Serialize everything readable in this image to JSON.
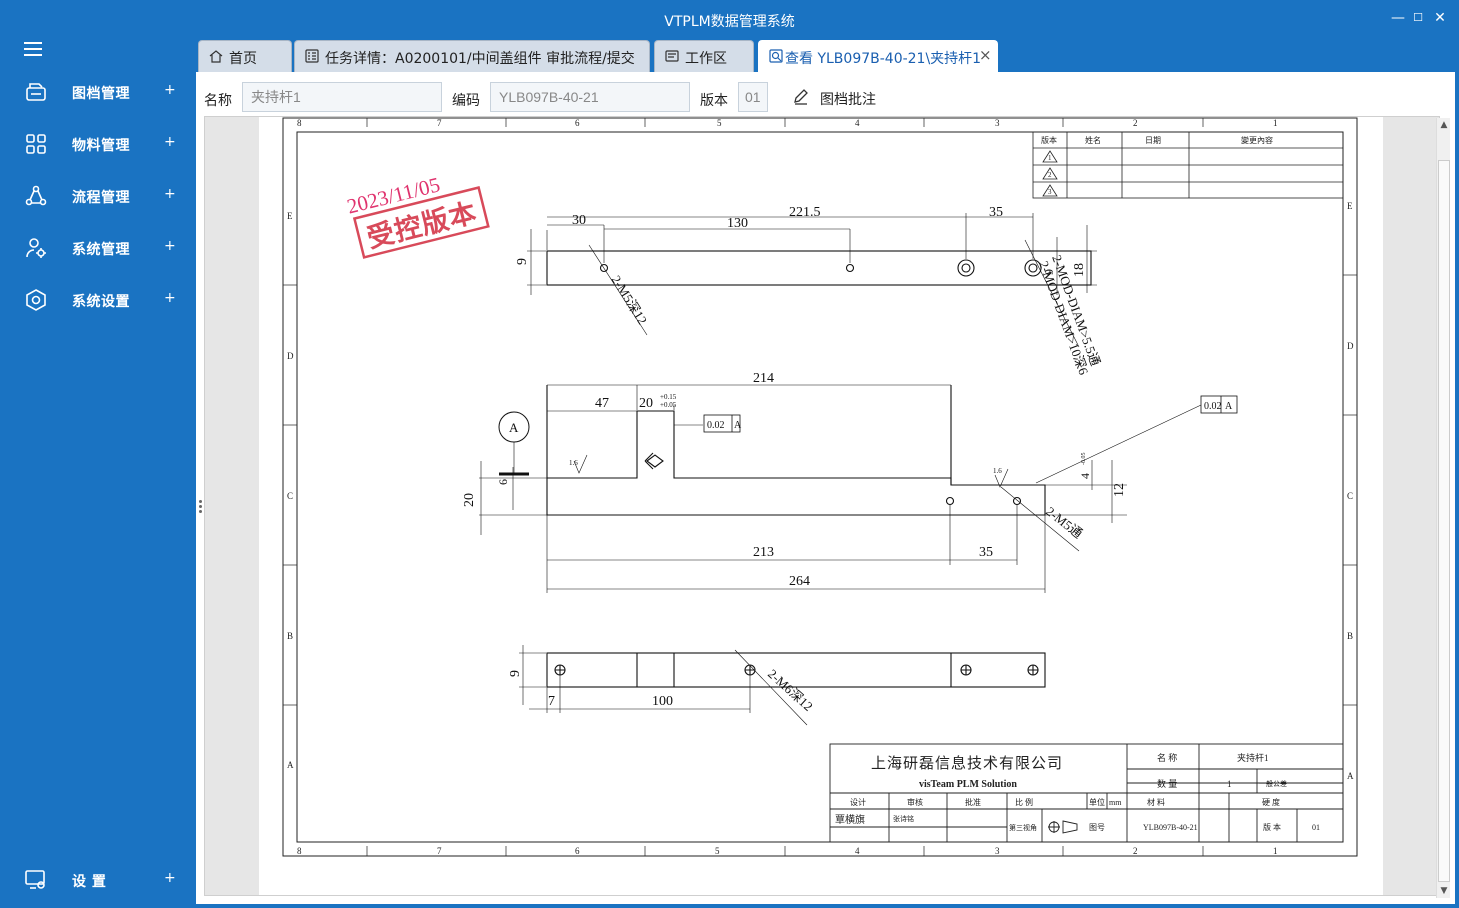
{
  "app": {
    "title": "VTPLM数据管理系统"
  },
  "window_controls": {
    "minimize": "—",
    "maximize": "☐",
    "close": "✕"
  },
  "sidebar": {
    "items": [
      {
        "label": "图档管理",
        "plus": "+"
      },
      {
        "label": "物料管理",
        "plus": "+"
      },
      {
        "label": "流程管理",
        "plus": "+"
      },
      {
        "label": "系统管理",
        "plus": "+"
      },
      {
        "label": "系统设置",
        "plus": "+"
      }
    ],
    "footer": {
      "label": "设 置",
      "plus": "+"
    }
  },
  "tabs": [
    {
      "label": "首页",
      "icon": "home-icon"
    },
    {
      "label": "任务详情：A0200101/中间盖组件 审批流程/提交",
      "icon": "task-icon"
    },
    {
      "label": "工作区",
      "icon": "workspace-icon"
    },
    {
      "label": "查看 YLB097B-40-21\\夹持杆1",
      "icon": "view-icon",
      "close": "×"
    }
  ],
  "form": {
    "name_label": "名称",
    "name_value": "夹持杆1",
    "code_label": "编码",
    "code_value": "YLB097B-40-21",
    "version_label": "版本",
    "version_value": "01",
    "annotate_label": "图档批注"
  },
  "drawing": {
    "stamp_date": "2023/11/05",
    "stamp_text": "受控版本",
    "rev_headers": [
      "版本",
      "姓名",
      "日期",
      "變更內容"
    ],
    "rev_rows": [
      "1",
      "2",
      "3"
    ],
    "col_numbers": [
      "8",
      "7",
      "6",
      "5",
      "4",
      "3",
      "2",
      "1"
    ],
    "row_letters": [
      "E",
      "D",
      "C",
      "B",
      "A"
    ],
    "view1": {
      "d30": "30",
      "d130": "130",
      "d221": "221.5",
      "d35": "35",
      "d9": "9",
      "d18": "18",
      "d9b": "9",
      "note_m5": "2-M5深12",
      "note_mod1": "2-MOD-DIAM>5.5通",
      "note_mod2": "2-MOD-DIAM>10深6"
    },
    "view2": {
      "d214": "214",
      "d47": "47",
      "d20": "20",
      "tol_up": "+0.15",
      "tol_dn": "+0.05",
      "gtol1_val": "0.02",
      "gtol1_ref": "A",
      "gtol2_val": "0.02",
      "gtol2_ref": "A",
      "datum": "A",
      "rough1": "1.6",
      "rough2": "1.6",
      "d6": "6",
      "d20v": "20",
      "d4": "4",
      "d4tol": "-0.05",
      "d12": "12",
      "d213": "213",
      "d35b": "35",
      "d264": "264",
      "note_m5": "2-M5通"
    },
    "view3": {
      "d9": "9",
      "d7": "7",
      "d100": "100",
      "note_m6": "2-M6深12"
    },
    "title_block": {
      "company": "上海研磊信息技术有限公司",
      "subtitle": "visTeam PLM Solution",
      "name_label": "名 称",
      "name_value": "夹持杆1",
      "qty_label": "数 量",
      "qty_value": "1",
      "tol_label": "一般公差",
      "hdr": [
        "设计",
        "审核",
        "批准",
        "比 例",
        "单位",
        "mm",
        "材 料",
        "硬 度"
      ],
      "designer": "覃横旗",
      "checker": "张诗铭",
      "projection": "第三视角",
      "dwg_label": "图号",
      "dwg_value": "YLB097B-40-21",
      "ver_label": "版 本",
      "ver_value": "01"
    }
  }
}
